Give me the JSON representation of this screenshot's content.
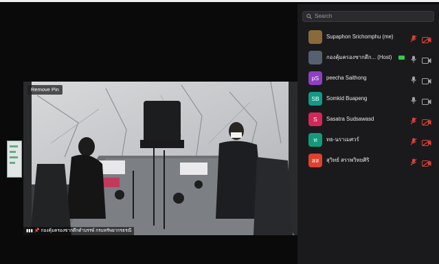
{
  "video": {
    "pin_button_label": "Remove Pin",
    "speaker_name": "กองคุ้มครองซากดึกดำบรรพ์ กรมทรัพยากรธรณี"
  },
  "participants_panel": {
    "search_placeholder": "Search",
    "participants": [
      {
        "name": "Supaphon Srichomphu (me)",
        "avatar_text": "",
        "avatar_color": "#8a6a3a",
        "mic": "muted",
        "video": "off"
      },
      {
        "name": "กองคุ้มครองซากดึก... (Host)",
        "avatar_text": "",
        "avatar_color": "#556070",
        "mic": "on",
        "video": "on"
      },
      {
        "name": "peecha Saithong",
        "avatar_text": "pS",
        "avatar_color": "#8e3fc4",
        "mic": "on",
        "video": "on"
      },
      {
        "name": "Somkid Buapeng",
        "avatar_text": "SB",
        "avatar_color": "#129a86",
        "mic": "on",
        "video": "on"
      },
      {
        "name": "Sasatra Sudsawasd",
        "avatar_text": "S",
        "avatar_color": "#d1285a",
        "mic": "muted",
        "video": "off"
      },
      {
        "name": "ทธ-นราเมศวร์",
        "avatar_text": "ท",
        "avatar_color": "#139a7a",
        "mic": "muted",
        "video": "off"
      },
      {
        "name": "สุวิทย์ สรรพวิทยศิริ",
        "avatar_text": "สส",
        "avatar_color": "#e0412e",
        "mic": "muted",
        "video": "off"
      }
    ]
  }
}
